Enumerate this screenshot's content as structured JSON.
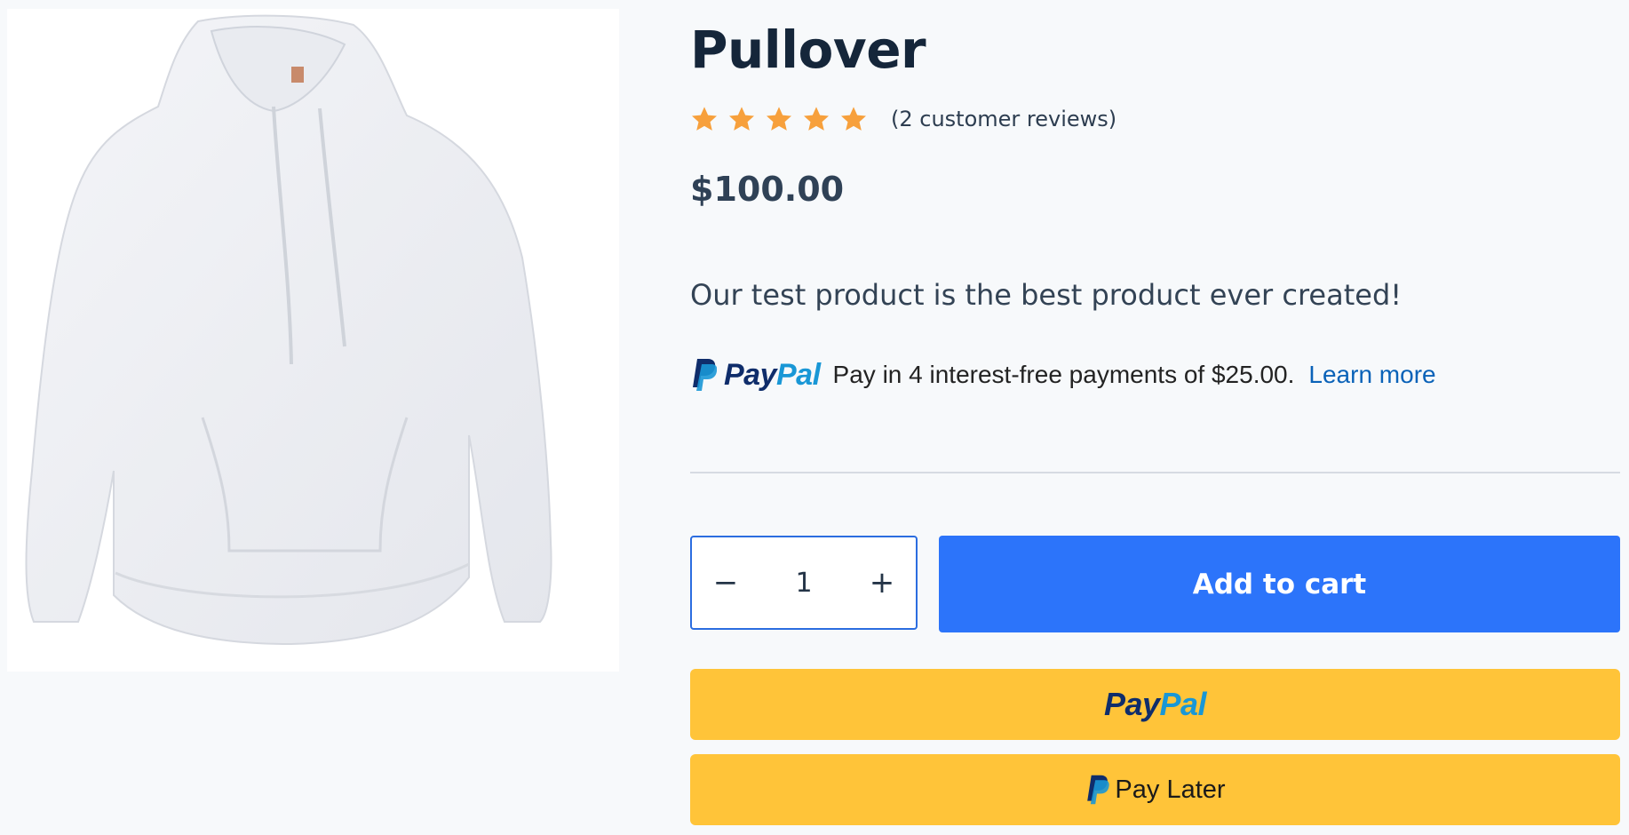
{
  "product": {
    "title": "Pullover",
    "rating": {
      "value": 5,
      "max": 5,
      "reviews_text": "(2 customer reviews)"
    },
    "price": "$100.00",
    "description": "Our test product is the best product ever created!"
  },
  "paypal_message": {
    "brand_part1": "Pay",
    "brand_part2": "Pal",
    "text": "Pay in 4 interest-free payments of $25.00.",
    "link": "Learn more"
  },
  "cart": {
    "decrement_label": "−",
    "quantity": "1",
    "increment_label": "+",
    "add_to_cart_label": "Add to cart"
  },
  "payment_buttons": {
    "paypal_part1": "Pay",
    "paypal_part2": "Pal",
    "pay_later_label": "Pay Later"
  },
  "colors": {
    "primary": "#2c74fa",
    "star": "#f7a03c",
    "paypal_yellow": "#ffc439",
    "paypal_dark_blue": "#0f2d6b",
    "paypal_light_blue": "#1997d6",
    "link": "#0a62b8"
  }
}
